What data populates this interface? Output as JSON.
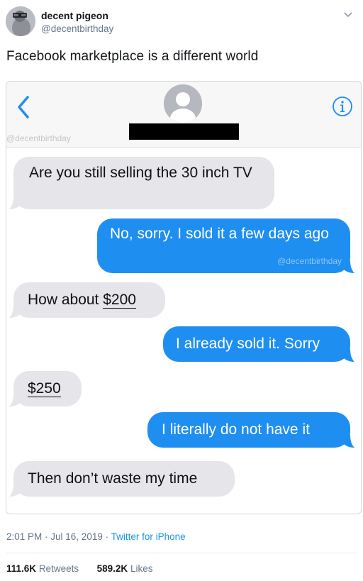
{
  "author": {
    "name": "decent pigeon",
    "handle": "@decentbirthday"
  },
  "tweet": {
    "text": "Facebook marketplace is a different world"
  },
  "screenshot": {
    "watermark": "@decentbirthday",
    "messages": [
      {
        "side": "in",
        "text": "Are you still selling the 30 inch TV"
      },
      {
        "side": "out",
        "text": "No, sorry. I sold it a few days ago"
      },
      {
        "side": "in",
        "prefix": "How about ",
        "amount": "$200"
      },
      {
        "side": "out",
        "text": "I already sold it. Sorry"
      },
      {
        "side": "in",
        "amount": "$250"
      },
      {
        "side": "out",
        "text": "I literally do not have it"
      },
      {
        "side": "in",
        "text": "Then don’t waste my time"
      }
    ]
  },
  "meta": {
    "time": "2:01 PM",
    "sep": " · ",
    "date": "Jul 16, 2019",
    "source": "Twitter for iPhone"
  },
  "stats": {
    "retweets_count": "111.6K",
    "retweets_label": "Retweets",
    "likes_count": "589.2K",
    "likes_label": "Likes"
  },
  "colors": {
    "outgoing_bubble": "#1f8ef1",
    "incoming_bubble": "#e5e5ea",
    "link": "#1b95e0"
  }
}
